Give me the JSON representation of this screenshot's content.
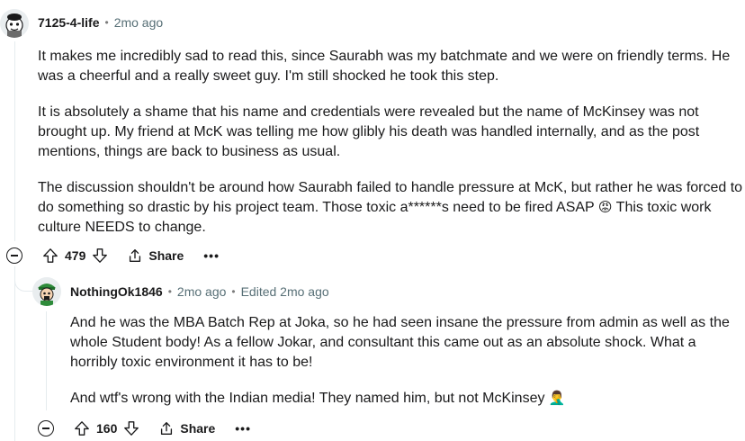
{
  "comments": [
    {
      "author": "7125-4-life",
      "time": "2mo ago",
      "paragraphs": [
        "It makes me incredibly sad to read this, since Saurabh was my batchmate and we were on friendly terms. He was a cheerful and a really sweet guy. I'm still shocked he took this step.",
        "It is absolutely a shame that his name and credentials were revealed but the name of McKinsey was not brought up. My friend at McK was telling me how glibly his death was handled internally, and as the post mentions, things are back to business as usual.",
        "The discussion shouldn't be around how Saurabh failed to handle pressure at McK, but rather he was forced to do something so drastic by his project team. Those toxic a******s need to be fired ASAP",
        "This toxic work culture NEEDS to change."
      ],
      "emoji": "😡",
      "score": "479",
      "share_label": "Share",
      "more_label": "•••"
    },
    {
      "author": "NothingOk1846",
      "time": "2mo ago",
      "edited": "Edited 2mo ago",
      "paragraphs": [
        "And he was the MBA Batch Rep at Joka, so he had seen insane the pressure from admin as well as the whole Student body! As a fellow Jokar, and consultant this came out as an absolute shock. What a horribly toxic environment it has to be!",
        "And wtf's wrong with the Indian media! They named him, but not McKinsey"
      ],
      "emoji": "🤦‍♂️",
      "score": "160",
      "share_label": "Share",
      "more_label": "•••"
    }
  ]
}
